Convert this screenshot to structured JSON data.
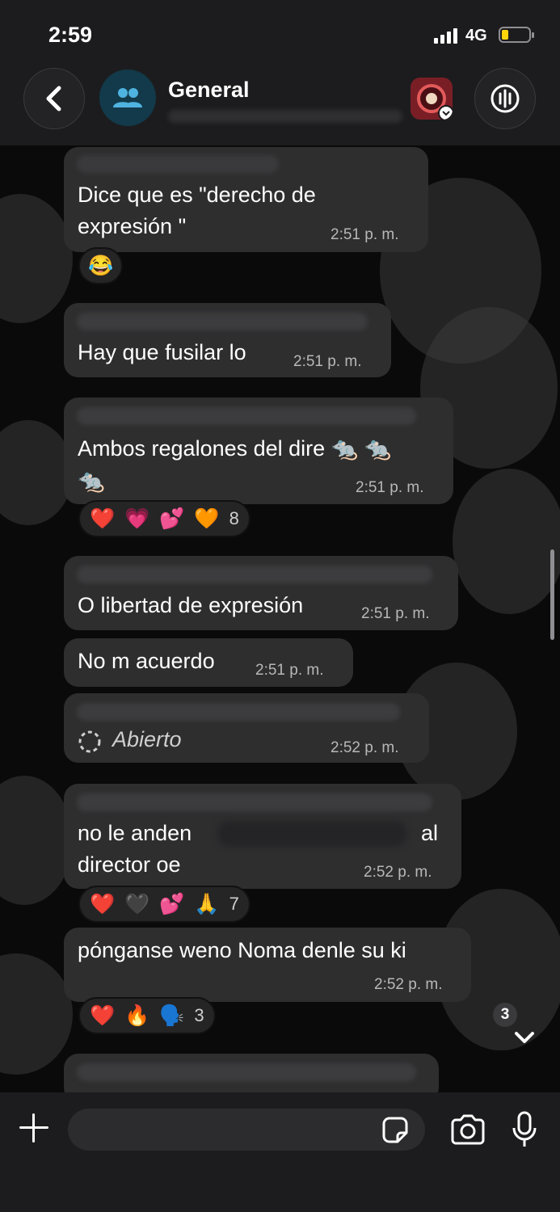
{
  "status_bar": {
    "time": "2:59",
    "network": "4G"
  },
  "header": {
    "title": "General"
  },
  "messages": [
    {
      "text_line1": "Dice que es \"derecho de",
      "text_line2": "expresión \"",
      "time": "2:51 p. m.",
      "reactions": [
        "😂"
      ]
    },
    {
      "text": "Hay que fusilar lo",
      "time": "2:51 p. m."
    },
    {
      "text_line1": "Ambos regalones del dire 🐀 🐀",
      "text_line2": "🐀",
      "time": "2:51 p. m.",
      "reactions": [
        "❤️",
        "💗",
        "💕",
        "🧡"
      ],
      "reaction_count": "8"
    },
    {
      "text": "O libertad de expresión",
      "time": "2:51 p. m."
    },
    {
      "text": "No m acuerdo",
      "time": "2:51 p. m."
    },
    {
      "text": "Abierto",
      "time": "2:52 p. m."
    },
    {
      "text_line1_start": "no le anden",
      "text_line1_end": "al",
      "text_line2": "director oe",
      "time": "2:52 p. m.",
      "reactions": [
        "❤️",
        "🖤",
        "💕",
        "🙏"
      ],
      "reaction_count": "7"
    },
    {
      "text": "pónganse weno Noma denle su ki",
      "time": "2:52 p. m.",
      "reactions": [
        "❤️",
        "🔥",
        "🗣️"
      ],
      "reaction_count": "3"
    }
  ],
  "scroll_down": {
    "unread_count": "3"
  },
  "colors": {
    "background": "#0a0a0a",
    "bubble": "#2e2e2f",
    "bar": "#1c1c1e",
    "battery": "#ffd60a"
  }
}
